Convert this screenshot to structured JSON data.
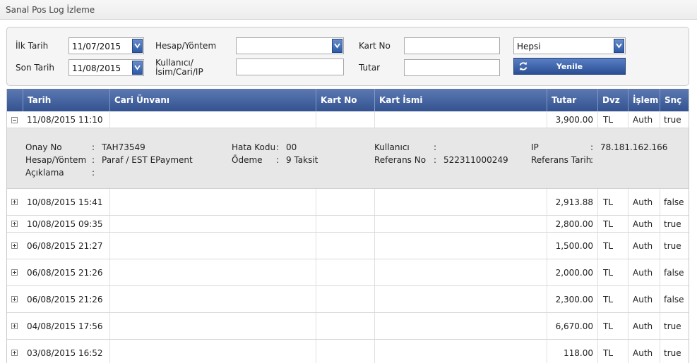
{
  "page": {
    "title": "Sanal Pos Log İzleme"
  },
  "filters": {
    "start_date_label": "İlk Tarih",
    "start_date_value": "11/07/2015",
    "end_date_label": "Son Tarih",
    "end_date_value": "11/08/2015",
    "account_method_label": "Hesap/Yöntem",
    "account_method_value": "",
    "user_label": "Kullanıcı/ İsim/Cari/IP",
    "user_value": "",
    "card_no_label": "Kart No",
    "card_no_value": "",
    "amount_label": "Tutar",
    "amount_value": "",
    "status_select_value": "Hepsi",
    "refresh_label": "Yenile"
  },
  "table": {
    "columns": [
      "Tarih",
      "Cari Ünvanı",
      "Kart No",
      "Kart İsmi",
      "Tutar",
      "Dvz",
      "İşlem",
      "Snç"
    ],
    "expanded_row": {
      "date": "11/08/2015 11:10",
      "amount": "3,900.00",
      "currency": "TL",
      "action": "Auth",
      "result": "true",
      "detail": {
        "approval_label": "Onay No",
        "approval_value": "TAH73549",
        "method_label": "Hesap/Yöntem",
        "method_value": "Paraf / EST EPayment",
        "desc_label": "Açıklama",
        "desc_value": "",
        "error_label": "Hata Kodu",
        "error_value": "00",
        "payment_label": "Ödeme",
        "payment_value": "9 Taksit",
        "user_label": "Kullanıcı",
        "user_value": "",
        "ref_label": "Referans No",
        "ref_value": "522311000249",
        "ip_label": "IP",
        "ip_value": "78.181.162.166",
        "ref_date_label": "Referans Tarih",
        "ref_date_value": "",
        "colon": ":"
      }
    },
    "rows": [
      {
        "date": "10/08/2015 15:41",
        "amount": "2,913.88",
        "currency": "TL",
        "action": "Auth",
        "result": "false"
      },
      {
        "date": "10/08/2015 09:35",
        "amount": "2,800.00",
        "currency": "TL",
        "action": "Auth",
        "result": "true"
      },
      {
        "date": "06/08/2015 21:27",
        "amount": "1,500.00",
        "currency": "TL",
        "action": "Auth",
        "result": "true"
      },
      {
        "date": "06/08/2015 21:26",
        "amount": "2,000.00",
        "currency": "TL",
        "action": "Auth",
        "result": "false"
      },
      {
        "date": "06/08/2015 21:26",
        "amount": "2,300.00",
        "currency": "TL",
        "action": "Auth",
        "result": "false"
      },
      {
        "date": "04/08/2015 17:56",
        "amount": "6,670.00",
        "currency": "TL",
        "action": "Auth",
        "result": "true"
      },
      {
        "date": "03/08/2015 16:52",
        "amount": "118.00",
        "currency": "TL",
        "action": "Auth",
        "result": "true"
      }
    ]
  },
  "colors": {
    "header_blue": "#33528f",
    "detail_bg": "#e7e7e7"
  }
}
